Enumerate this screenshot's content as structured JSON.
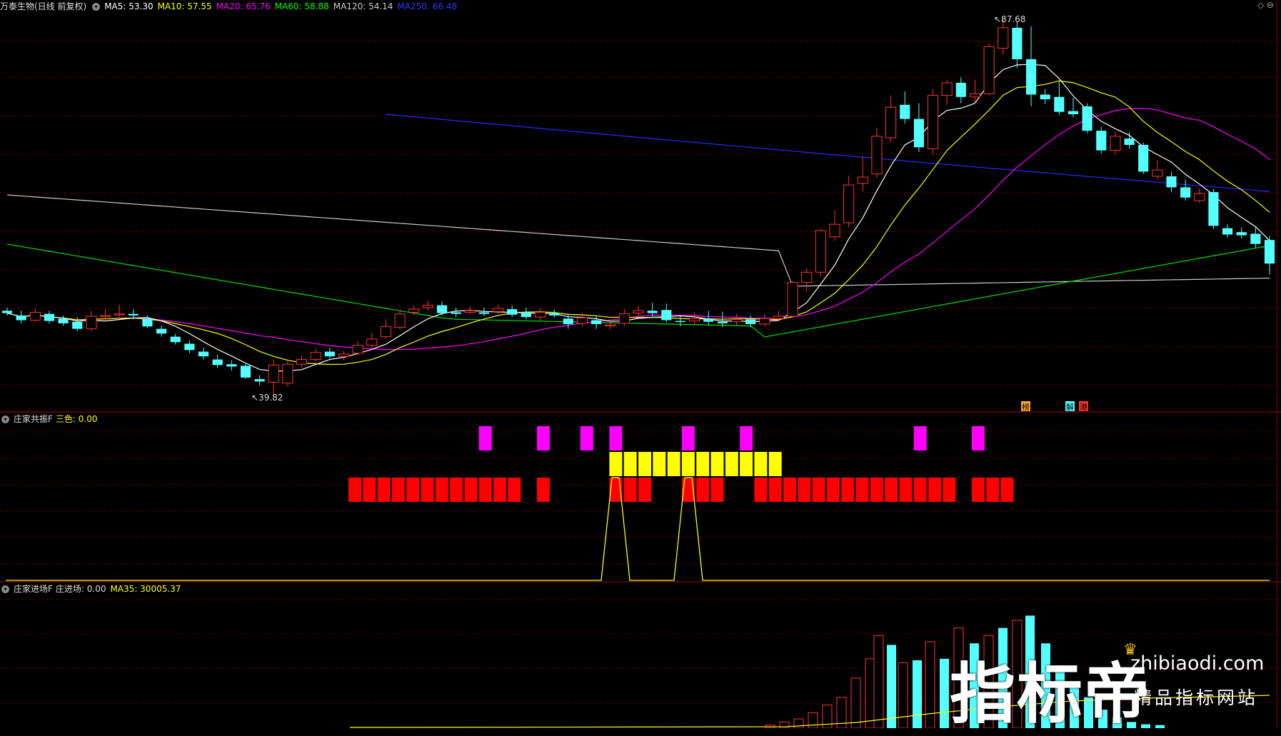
{
  "main_panel": {
    "title": "万泰生物(日线 前复权)",
    "ma_items": [
      {
        "label": "MA5: 53.30",
        "color": "#ffffff"
      },
      {
        "label": "MA10: 57.55",
        "color": "#ffff00"
      },
      {
        "label": "MA20: 65.76",
        "color": "#ff00ff"
      },
      {
        "label": "MA60: 58.88",
        "color": "#00ff00"
      },
      {
        "label": "MA120: 54.14",
        "color": "#cccccc"
      },
      {
        "label": "MA250: 66.48",
        "color": "#3333ff"
      }
    ],
    "high_label": "87.68",
    "low_label": "39.82",
    "markers": [
      "榜",
      "解",
      "港"
    ],
    "corner_icons": "◇ ⊖"
  },
  "panel2": {
    "title": "庄家共振F",
    "value_label": "三色: 0.00",
    "value_color": "#ffff00"
  },
  "panel3": {
    "title": "庄家进场F",
    "value_label": "庄进场: 0.00",
    "ma_label": "MA35: 30005.37",
    "ma_color": "#ffff00"
  },
  "watermark": {
    "big_text": "指标帝",
    "url": "zhibiaodi.com",
    "subtitle": "精品指标网站"
  },
  "colors": {
    "up": "#ff3333",
    "down": "#54ffff",
    "grid": "#7a0000",
    "magenta": "#ff00ff",
    "yellow": "#ffff00",
    "red": "#ff0000"
  }
}
